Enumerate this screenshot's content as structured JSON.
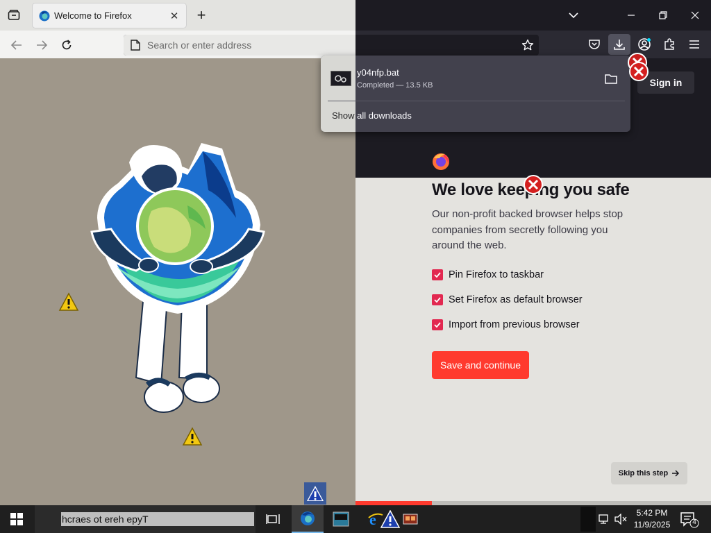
{
  "browser": {
    "tab": {
      "title": "Welcome to Firefox"
    },
    "urlbar": {
      "placeholder": "Search or enter address"
    }
  },
  "toolbar": {
    "icons": [
      "tab-list-icon",
      "back-icon",
      "forward-icon",
      "reload-icon",
      "bookmark-star-icon",
      "pocket-icon",
      "download-icon",
      "account-icon",
      "extensions-icon",
      "menu-icon"
    ]
  },
  "downloads_panel": {
    "filename": "y04nfp.bat",
    "status": "Completed — 13.5 KB",
    "show_all": "Show all downloads"
  },
  "page": {
    "signin_label": "Sign in",
    "headline": "We love keeping you safe",
    "subtext": "Our non-profit backed browser helps stop companies from secretly following you around the web.",
    "options": [
      {
        "label": "Pin Firefox to taskbar",
        "checked": true
      },
      {
        "label": "Set Firefox as default browser",
        "checked": true
      },
      {
        "label": "Import from previous browser",
        "checked": true
      }
    ],
    "save_label": "Save and continue",
    "skip_label": "Skip this step",
    "progress": 0.215
  },
  "taskbar": {
    "search_text": "hcraes ot ereh epyT",
    "time": "5:42 PM",
    "date": "11/9/2025",
    "notification_count": "4"
  },
  "colors": {
    "accent": "#ff3a2e",
    "checkbox": "#e22850",
    "dark_chrome": "#1c1b22"
  }
}
